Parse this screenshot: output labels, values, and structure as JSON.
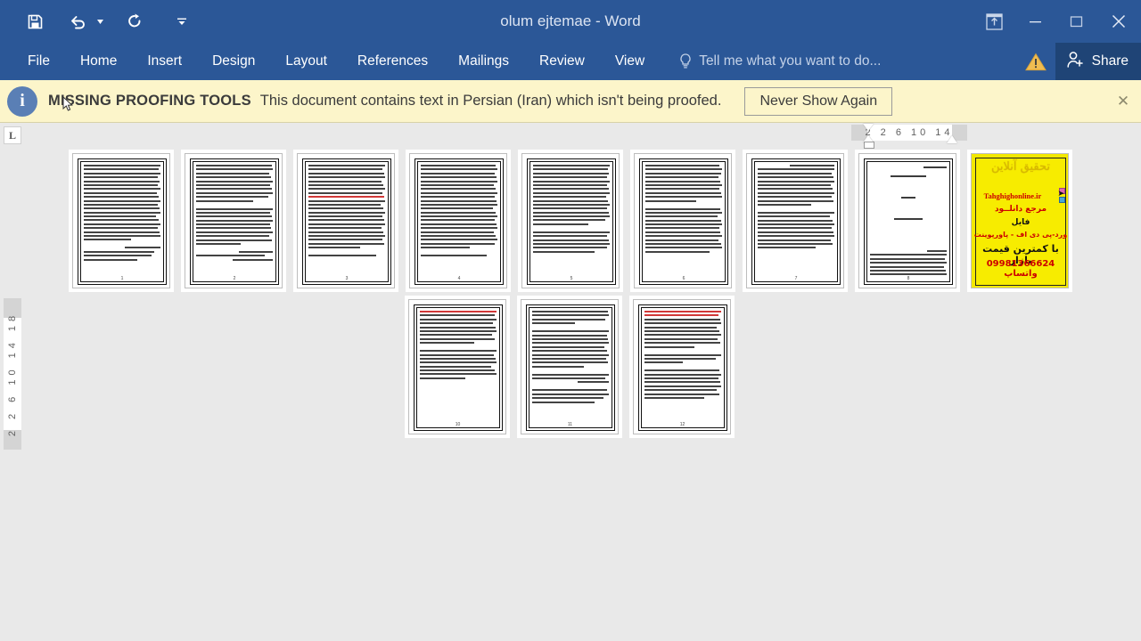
{
  "window": {
    "title": "olum ejtemae - Word",
    "quick_access": [
      {
        "name": "save-button",
        "icon": "save-icon",
        "label": "Save"
      },
      {
        "name": "undo-button",
        "icon": "undo-icon",
        "label": "Undo"
      },
      {
        "name": "undo-dropdown",
        "icon": "chevron-down-icon",
        "label": "Undo options"
      },
      {
        "name": "redo-button",
        "icon": "redo-icon",
        "label": "Redo"
      },
      {
        "name": "customize-qat-button",
        "icon": "chevron-down-icon",
        "label": "Customize Quick Access Toolbar"
      }
    ],
    "controls": [
      {
        "name": "ribbon-display-options-button",
        "icon": "ribbon-display-icon",
        "label": "Ribbon Display Options"
      },
      {
        "name": "minimize-button",
        "icon": "minimize-icon",
        "label": "Minimize"
      },
      {
        "name": "restore-button",
        "icon": "restore-icon",
        "label": "Restore Down"
      },
      {
        "name": "close-button",
        "icon": "close-icon",
        "label": "Close"
      }
    ]
  },
  "ribbon": {
    "tabs": [
      {
        "label": "File"
      },
      {
        "label": "Home"
      },
      {
        "label": "Insert"
      },
      {
        "label": "Design"
      },
      {
        "label": "Layout"
      },
      {
        "label": "References"
      },
      {
        "label": "Mailings"
      },
      {
        "label": "Review"
      },
      {
        "label": "View"
      }
    ],
    "tell_me": {
      "icon": "lightbulb-icon",
      "placeholder": "Tell me what you want to do..."
    },
    "warning": {
      "icon": "warning-triangle-icon"
    },
    "share": {
      "icon": "person-add-icon",
      "label": "Share"
    }
  },
  "notification": {
    "icon": "info-circle-icon",
    "icon_glyph": "i",
    "title": "MISSING PROOFING TOOLS",
    "message": "This document contains text in Persian (Iran) which isn't being proofed.",
    "action_label": "Never Show Again",
    "close": {
      "icon": "close-icon",
      "glyph": "✕"
    }
  },
  "rulers": {
    "tab_selector": {
      "icon": "left-tab-stop-icon",
      "glyph": "L"
    },
    "horizontal": {
      "ticks": "2 2 6 10 14"
    },
    "vertical": {
      "ticks": "2 2 6 10 14 18"
    }
  },
  "document": {
    "colors": {
      "ribbon_blue": "#2b5797",
      "share_blue": "#1f4476",
      "notify_yellow": "#fcf5ca",
      "ad_yellow": "#f2e800",
      "ad_red": "#cc0000",
      "canvas_gray": "#e9e9e9"
    },
    "ad_page": {
      "headline": "تحقیق آنلاین",
      "site": "Tahghighonline.ir",
      "line1": "مرجع دانلــود",
      "line2": "فایل",
      "line3": "ورد-پی دی اف - پاورپوینت",
      "line4": "با کمترین قیمت بازار",
      "line5": "09981366624 واتساپ"
    },
    "pages": [
      {
        "n": 1,
        "kind": "text",
        "pnum": "1"
      },
      {
        "n": 2,
        "kind": "text",
        "pnum": "2"
      },
      {
        "n": 3,
        "kind": "text-red",
        "pnum": "3"
      },
      {
        "n": 4,
        "kind": "text",
        "pnum": "4"
      },
      {
        "n": 5,
        "kind": "text",
        "pnum": "5"
      },
      {
        "n": 6,
        "kind": "text",
        "pnum": "6"
      },
      {
        "n": 7,
        "kind": "text",
        "pnum": "7"
      },
      {
        "n": 8,
        "kind": "title",
        "pnum": "8"
      },
      {
        "n": 9,
        "kind": "ad",
        "pnum": ""
      },
      {
        "n": 10,
        "kind": "text-red",
        "pnum": "10"
      },
      {
        "n": 11,
        "kind": "text",
        "pnum": "11"
      },
      {
        "n": 12,
        "kind": "text-red",
        "pnum": "12"
      }
    ]
  }
}
